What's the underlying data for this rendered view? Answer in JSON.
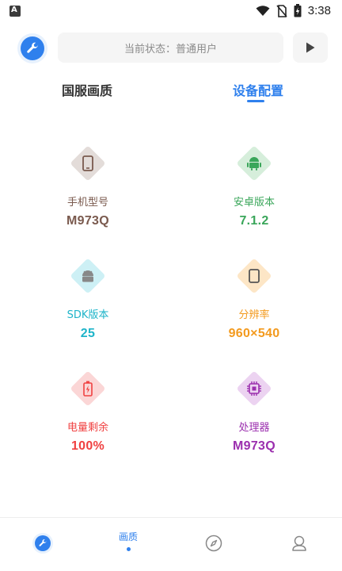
{
  "status_bar": {
    "time": "3:38"
  },
  "header": {
    "status_text": "当前状态：普通用户"
  },
  "tabs": [
    {
      "label": "国服画质",
      "active": false
    },
    {
      "label": "设备配置",
      "active": true
    }
  ],
  "device_info": [
    {
      "label": "手机型号",
      "value": "M973Q",
      "icon": "phone-icon",
      "color": "#7a5a4e",
      "bg": "#e3dcd9"
    },
    {
      "label": "安卓版本",
      "value": "7.1.2",
      "icon": "android-icon",
      "color": "#3aa65a",
      "bg": "#d6eedb"
    },
    {
      "label": "SDK版本",
      "value": "25",
      "icon": "android-head-icon",
      "color": "#1eb4c9",
      "bg": "#cdf0f5"
    },
    {
      "label": "分辨率",
      "value": "960×540",
      "icon": "tablet-icon",
      "color": "#f39a1e",
      "bg": "#fde6c6"
    },
    {
      "label": "电量剩余",
      "value": "100%",
      "icon": "battery-charging-icon",
      "color": "#f04141",
      "bg": "#fbd6d6"
    },
    {
      "label": "处理器",
      "value": "M973Q",
      "icon": "chip-icon",
      "color": "#9b2fae",
      "bg": "#ecd3f1"
    }
  ],
  "bottom_nav": [
    {
      "label": "",
      "icon": "wrench-logo-icon"
    },
    {
      "label": "画质",
      "icon": "",
      "active": true
    },
    {
      "label": "",
      "icon": "compass-icon"
    },
    {
      "label": "",
      "icon": "user-icon"
    }
  ]
}
